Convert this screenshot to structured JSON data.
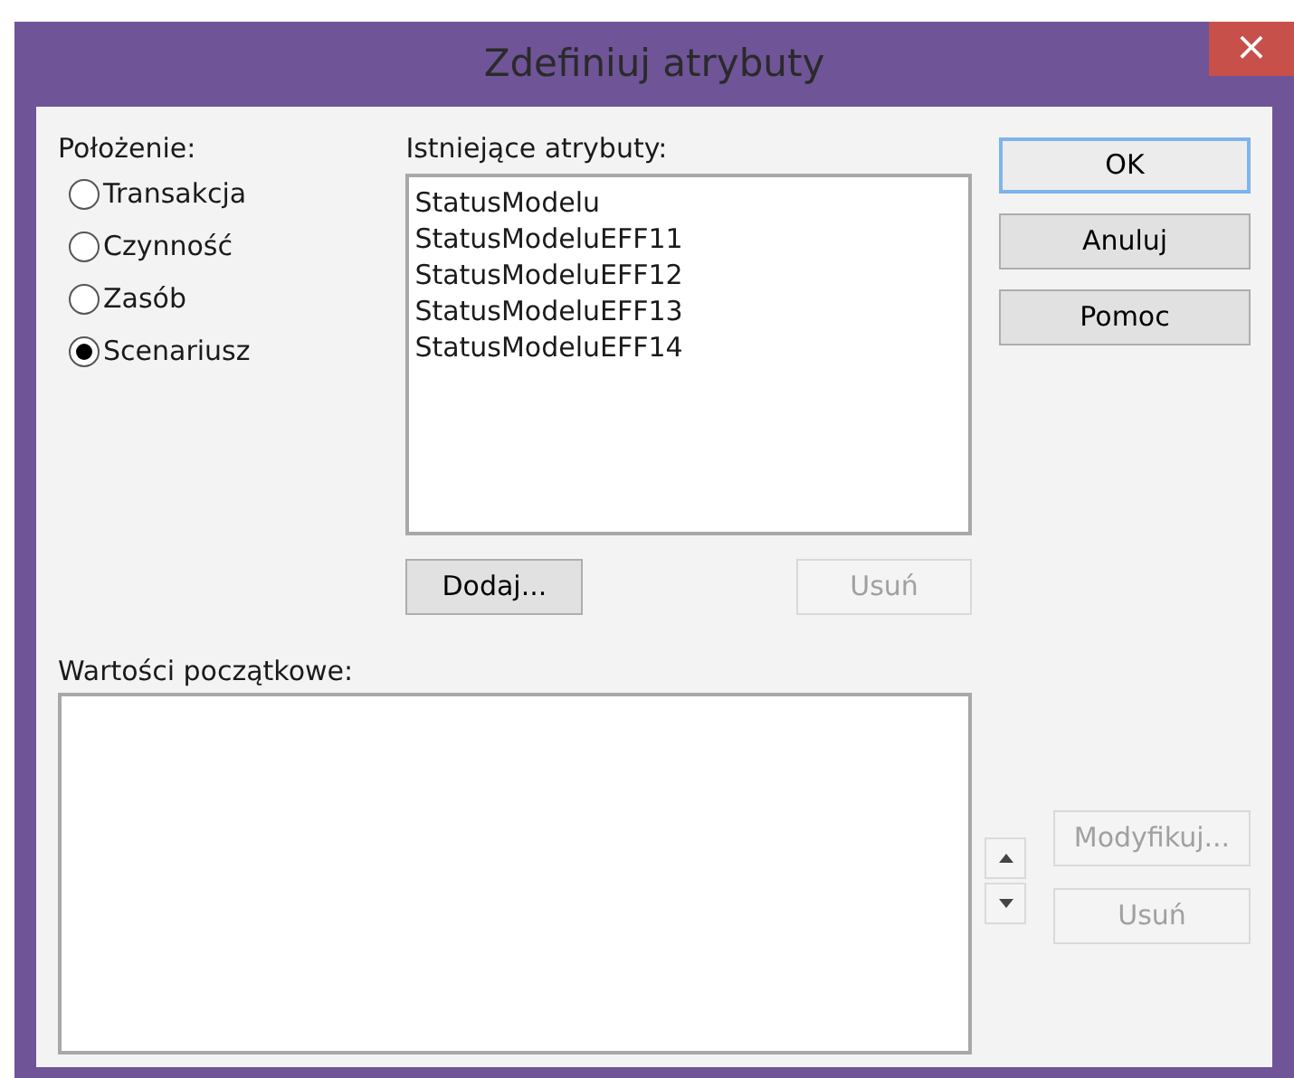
{
  "window": {
    "title": "Zdefiniuj atrybuty",
    "close": "×"
  },
  "placement": {
    "label": "Położenie:",
    "options": [
      {
        "label": "Transakcja",
        "selected": false
      },
      {
        "label": "Czynność",
        "selected": false
      },
      {
        "label": "Zasób",
        "selected": false
      },
      {
        "label": "Scenariusz",
        "selected": true
      }
    ]
  },
  "attributes": {
    "label": "Istniejące atrybuty:",
    "items": [
      "StatusModelu",
      "StatusModeluEFF11",
      "StatusModeluEFF12",
      "StatusModeluEFF13",
      "StatusModeluEFF14"
    ],
    "buttons": [
      {
        "label": "Dodaj...",
        "disabled": false
      },
      {
        "label": "Usuń",
        "disabled": true
      }
    ]
  },
  "dialog_buttons": [
    {
      "label": "OK",
      "default": true,
      "disabled": false
    },
    {
      "label": "Anuluj",
      "default": false,
      "disabled": false
    },
    {
      "label": "Pomoc",
      "default": false,
      "disabled": false
    }
  ],
  "initial_values": {
    "label": "Wartości początkowe:",
    "buttons": [
      {
        "label": "Modyfikuj...",
        "disabled": true
      },
      {
        "label": "Usuń",
        "disabled": true
      }
    ]
  }
}
